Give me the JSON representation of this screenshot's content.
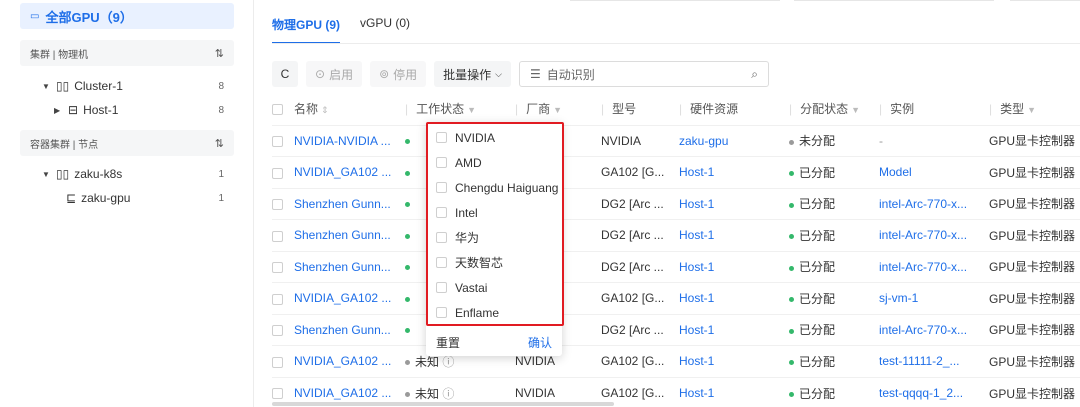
{
  "sidebar": {
    "all_gpu": "全部GPU（9）",
    "cluster_section": "集群 | 物理机",
    "cluster": {
      "name": "Cluster-1",
      "count": "8"
    },
    "host": {
      "name": "Host-1",
      "count": "8"
    },
    "container_section": "容器集群 | 节点",
    "k8s": {
      "name": "zaku-k8s",
      "count": "1"
    },
    "node": {
      "name": "zaku-gpu",
      "count": "1"
    }
  },
  "tabs": [
    {
      "label": "物理GPU (9)"
    },
    {
      "label": "vGPU (0)"
    }
  ],
  "toolbar": {
    "refresh": "C",
    "enable": "启用",
    "disable": "停用",
    "batch": "批量操作",
    "search_placeholder": "自动识别"
  },
  "columns": [
    "名称",
    "工作状态",
    "厂商",
    "型号",
    "硬件资源",
    "分配状态",
    "实例",
    "类型"
  ],
  "rows": [
    {
      "name": "NVIDIA-NVIDIA ...",
      "status": "",
      "vendor": "",
      "model": "NVIDIA",
      "hw": "zaku-gpu",
      "alloc": "未分配",
      "instance": "-",
      "type": "GPU显卡控制器"
    },
    {
      "name": "NVIDIA_GA102 ...",
      "status": "",
      "vendor": "",
      "model": "GA102 [G...",
      "hw": "Host-1",
      "alloc": "已分配",
      "instance": "Model",
      "type": "GPU显卡控制器"
    },
    {
      "name": "Shenzhen Gunn...",
      "status": "",
      "vendor": "",
      "model": "DG2 [Arc ...",
      "hw": "Host-1",
      "alloc": "已分配",
      "instance": "intel-Arc-770-x...",
      "type": "GPU显卡控制器"
    },
    {
      "name": "Shenzhen Gunn...",
      "status": "",
      "vendor": "",
      "model": "DG2 [Arc ...",
      "hw": "Host-1",
      "alloc": "已分配",
      "instance": "intel-Arc-770-x...",
      "type": "GPU显卡控制器"
    },
    {
      "name": "Shenzhen Gunn...",
      "status": "",
      "vendor": "",
      "model": "DG2 [Arc ...",
      "hw": "Host-1",
      "alloc": "已分配",
      "instance": "intel-Arc-770-x...",
      "type": "GPU显卡控制器"
    },
    {
      "name": "NVIDIA_GA102 ...",
      "status": "",
      "vendor": "",
      "model": "GA102 [G...",
      "hw": "Host-1",
      "alloc": "已分配",
      "instance": "sj-vm-1",
      "type": "GPU显卡控制器"
    },
    {
      "name": "Shenzhen Gunn...",
      "status": "",
      "vendor": "",
      "model": "DG2 [Arc ...",
      "hw": "Host-1",
      "alloc": "已分配",
      "instance": "intel-Arc-770-x...",
      "type": "GPU显卡控制器"
    },
    {
      "name": "NVIDIA_GA102 ...",
      "status": "未知",
      "vendor": "NVIDIA",
      "model": "GA102 [G...",
      "hw": "Host-1",
      "alloc": "已分配",
      "instance": "test-11111-2_...",
      "type": "GPU显卡控制器"
    },
    {
      "name": "NVIDIA_GA102 ...",
      "status": "未知",
      "vendor": "NVIDIA",
      "model": "GA102 [G...",
      "hw": "Host-1",
      "alloc": "已分配",
      "instance": "test-qqqq-1_2...",
      "type": "GPU显卡控制器"
    }
  ],
  "vendor_filter": {
    "options": [
      "NVIDIA",
      "AMD",
      "Chengdu Haiguang",
      "Intel",
      "华为",
      "天数智芯",
      "Vastai",
      "Enflame"
    ],
    "reset": "重置",
    "confirm": "确认"
  }
}
